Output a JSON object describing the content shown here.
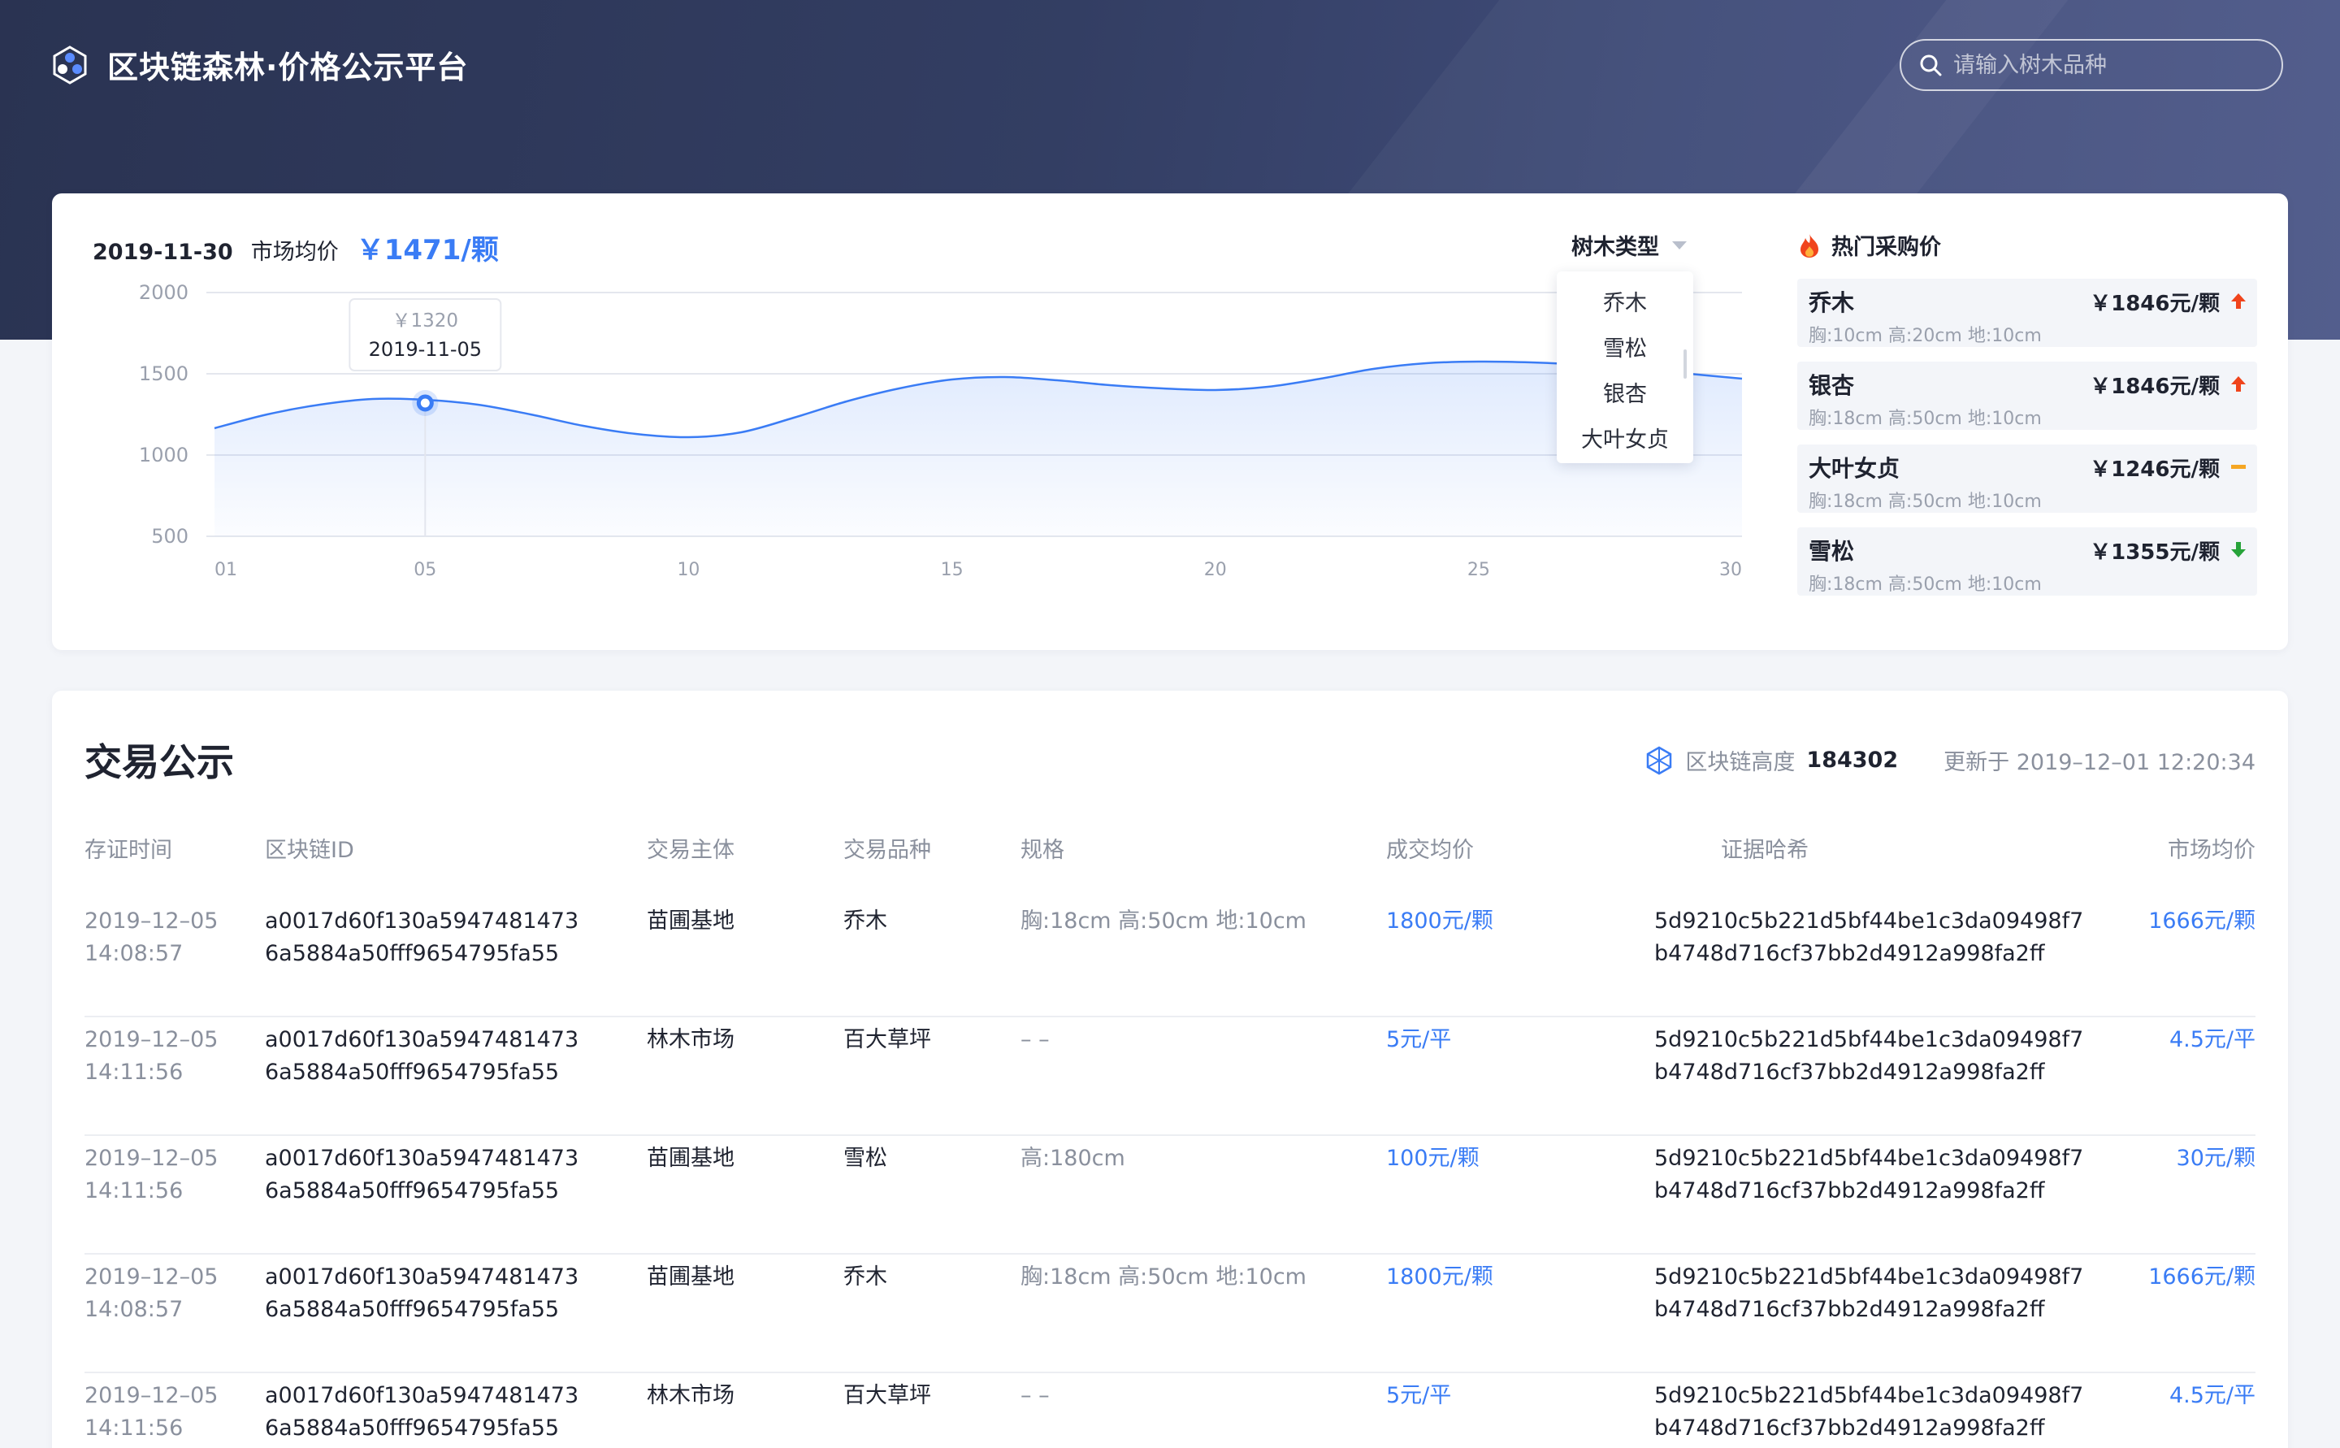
{
  "header": {
    "title": "区块链森林·价格公示平台",
    "search_placeholder": "请输入树木品种"
  },
  "summary": {
    "date": "2019-11-30",
    "label": "市场均价",
    "avg_price": "￥1471/颗"
  },
  "tree_type": {
    "label": "树木类型",
    "options": [
      "乔木",
      "雪松",
      "银杏",
      "大叶女贞"
    ]
  },
  "tooltip": {
    "value": "￥1320",
    "date": "2019-11-05"
  },
  "chart_data": {
    "type": "area",
    "x": [
      1,
      5,
      10,
      15,
      20,
      25,
      30
    ],
    "x_tick_labels": [
      "01",
      "05",
      "10",
      "15",
      "20",
      "25",
      "30"
    ],
    "y_ticks": [
      500,
      1000,
      1500,
      2000
    ],
    "ylim": [
      500,
      2000
    ],
    "grid": true,
    "series": [
      {
        "x": [
          1,
          2,
          3,
          4,
          5,
          6,
          7,
          8,
          9,
          10,
          11,
          12,
          13,
          14,
          15,
          16,
          17,
          18,
          19,
          20,
          21,
          22,
          23,
          24,
          25,
          26,
          27,
          28,
          29,
          30
        ],
        "values": [
          1165,
          1250,
          1310,
          1345,
          1340,
          1310,
          1250,
          1180,
          1130,
          1110,
          1140,
          1230,
          1330,
          1410,
          1465,
          1480,
          1460,
          1430,
          1410,
          1400,
          1420,
          1470,
          1530,
          1565,
          1575,
          1570,
          1555,
          1530,
          1500,
          1470
        ],
        "color": "#3a7cf5"
      }
    ],
    "highlight": {
      "x": 5,
      "value": 1320
    }
  },
  "hot": {
    "title": "热门采购价",
    "items": [
      {
        "name": "乔木",
        "spec": "胸:10cm  高:20cm  地:10cm",
        "price": "￥1846元/颗",
        "trend": "up"
      },
      {
        "name": "银杏",
        "spec": "胸:18cm 高:50cm 地:10cm",
        "price": "￥1846元/颗",
        "trend": "up"
      },
      {
        "name": "大叶女贞",
        "spec": "胸:18cm 高:50cm 地:10cm",
        "price": "￥1246元/颗",
        "trend": "flat"
      },
      {
        "name": "雪松",
        "spec": "胸:18cm 高:50cm 地:10cm",
        "price": "￥1355元/颗",
        "trend": "down"
      }
    ],
    "colors": {
      "up": "#f0441c",
      "flat": "#f5a623",
      "down": "#27a33a"
    }
  },
  "trades": {
    "title": "交易公示",
    "height_label": "区块链高度",
    "height_value": "184302",
    "updated": "更新于 2019–12–01 12:20:34",
    "columns": [
      "存证时间",
      "区块链ID",
      "交易主体",
      "交易品种",
      "规格",
      "成交均价",
      "证据哈希",
      "市场均价"
    ],
    "rows": [
      {
        "date": "2019–12–05",
        "time": "14:08:57",
        "id1": "a0017d60f130a5947481473",
        "id2": "6a5884a50fff9654795fa55",
        "party": "苗圃基地",
        "variety": "乔木",
        "spec": "胸:18cm 高:50cm 地:10cm",
        "deal": "1800元/颗",
        "hash1": "5d9210c5b221d5bf44be1c3da09498f7",
        "hash2": "b4748d716cf37bb2d4912a998fa2ff",
        "market": "1666元/颗"
      },
      {
        "date": "2019–12–05",
        "time": "14:11:56",
        "id1": "a0017d60f130a5947481473",
        "id2": "6a5884a50fff9654795fa55",
        "party": "林木市场",
        "variety": "百大草坪",
        "spec": "– –",
        "deal": "5元/平",
        "hash1": "5d9210c5b221d5bf44be1c3da09498f7",
        "hash2": "b4748d716cf37bb2d4912a998fa2ff",
        "market": "4.5元/平"
      },
      {
        "date": "2019–12–05",
        "time": "14:11:56",
        "id1": "a0017d60f130a5947481473",
        "id2": "6a5884a50fff9654795fa55",
        "party": "苗圃基地",
        "variety": "雪松",
        "spec": "高:180cm",
        "deal": "100元/颗",
        "hash1": "5d9210c5b221d5bf44be1c3da09498f7",
        "hash2": "b4748d716cf37bb2d4912a998fa2ff",
        "market": "30元/颗"
      },
      {
        "date": "2019–12–05",
        "time": "14:08:57",
        "id1": "a0017d60f130a5947481473",
        "id2": "6a5884a50fff9654795fa55",
        "party": "苗圃基地",
        "variety": "乔木",
        "spec": "胸:18cm 高:50cm 地:10cm",
        "deal": "1800元/颗",
        "hash1": "5d9210c5b221d5bf44be1c3da09498f7",
        "hash2": "b4748d716cf37bb2d4912a998fa2ff",
        "market": "1666元/颗"
      },
      {
        "date": "2019–12–05",
        "time": "14:11:56",
        "id1": "a0017d60f130a5947481473",
        "id2": "6a5884a50fff9654795fa55",
        "party": "林木市场",
        "variety": "百大草坪",
        "spec": "– –",
        "deal": "5元/平",
        "hash1": "5d9210c5b221d5bf44be1c3da09498f7",
        "hash2": "b4748d716cf37bb2d4912a998fa2ff",
        "market": "4.5元/平"
      }
    ]
  }
}
